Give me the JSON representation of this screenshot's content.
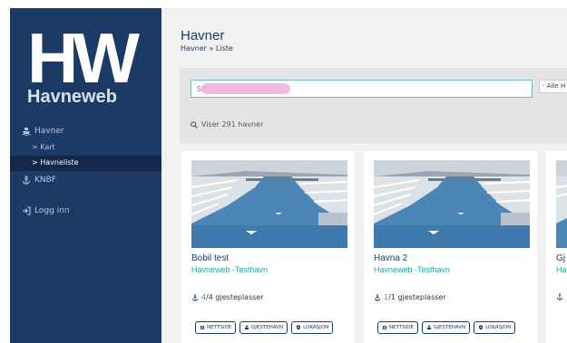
{
  "sidebar": {
    "logo_letters": "HW",
    "logo_word": "Havneweb",
    "nav": {
      "havner": "Havner",
      "kart": "Kart",
      "havneliste": "Havneliste",
      "knbf": "KNBF",
      "logg_inn": "Logg inn"
    }
  },
  "header": {
    "title": "Havner",
    "breadcrumb": "Havner » Liste"
  },
  "search": {
    "placeholder": "Søk...",
    "filter_value": "- Alle H",
    "result_count": "Viser 291 havner"
  },
  "cards": [
    {
      "title": "Bobil test",
      "subtitle": "Havneweb -Testhavn",
      "capacity_available": "4",
      "capacity_total": "/4 gjesteplasser",
      "actions": [
        "NETTSIDE",
        "GJESTEHAVN",
        "LOKASJON"
      ]
    },
    {
      "title": "Havna 2",
      "subtitle": "Havneweb -Testhavn",
      "capacity_available": "1",
      "capacity_total": "/1 gjesteplasser",
      "actions": [
        "NETTSIDE",
        "GJESTEHAVN",
        "LOKASJON"
      ]
    },
    {
      "title": "Gj",
      "subtitle": "Ha"
    }
  ],
  "colors": {
    "sidebar_bg": "#1c3a66",
    "accent_teal": "#1fa6a6",
    "main_bg": "#f1f1f1"
  }
}
